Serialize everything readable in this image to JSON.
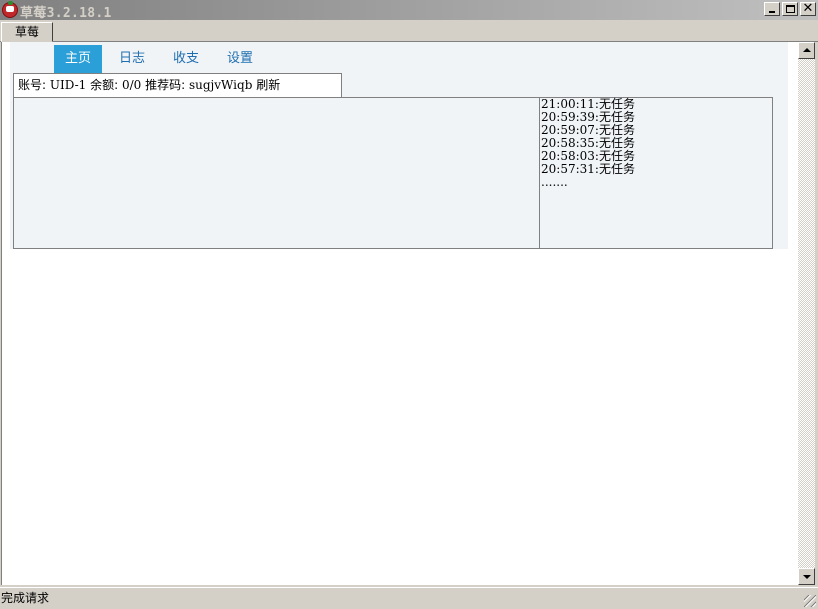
{
  "window": {
    "title": "草莓3.2.18.1",
    "controls": {
      "minimize_icon": "minimize-icon",
      "maximize_icon": "maximize-icon",
      "close_glyph": "✕"
    }
  },
  "outer_tab": {
    "label": "草莓"
  },
  "nav": {
    "items": [
      {
        "label": "主页",
        "active": true
      },
      {
        "label": "日志",
        "active": false
      },
      {
        "label": "收支",
        "active": false
      },
      {
        "label": "设置",
        "active": false
      }
    ]
  },
  "account": {
    "account_label": "账号:",
    "account_value": "UID-1",
    "balance_label": "余额:",
    "balance_value": "0/0",
    "referral_label": "推荐码:",
    "referral_value": "sugjvWiqb",
    "refresh_label": "刷新"
  },
  "log": {
    "entries": [
      "21:00:11:无任务",
      "20:59:39:无任务",
      "20:59:07:无任务",
      "20:58:35:无任务",
      "20:58:03:无任务",
      "20:57:31:无任务",
      "......."
    ]
  },
  "status": {
    "text": "完成请求"
  },
  "colors": {
    "nav_active_bg": "#2a9fd8",
    "nav_text": "#1f6fb0",
    "panel_bg": "#f0f4f7"
  }
}
